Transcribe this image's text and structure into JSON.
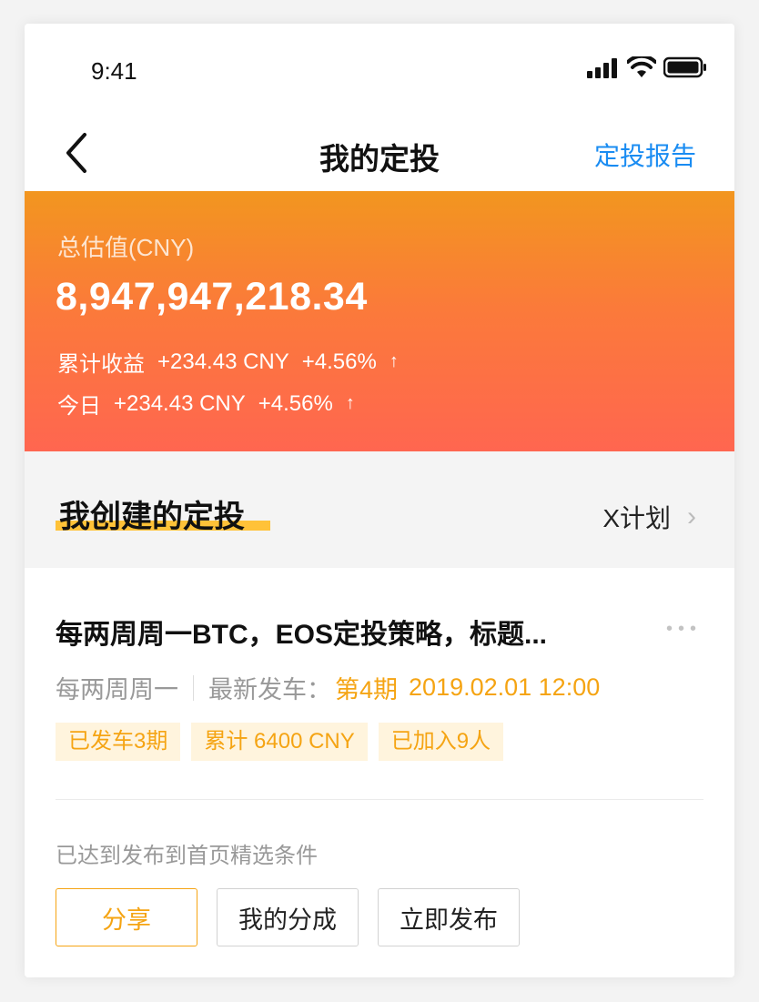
{
  "status_bar": {
    "time": "9:41"
  },
  "nav": {
    "title": "我的定投",
    "report_link": "定投报告"
  },
  "summary": {
    "total_label": "总估值(CNY)",
    "total_value": "8,947,947,218.34",
    "cumulative_label": "累计收益",
    "cumulative_amount": "+234.43 CNY",
    "cumulative_percent": "+4.56%",
    "today_label": "今日",
    "today_amount": "+234.43 CNY",
    "today_percent": "+4.56%",
    "arrow": "↑"
  },
  "section": {
    "title": "我创建的定投",
    "plan_link": "X计划",
    "chevron": "›"
  },
  "card": {
    "title": "每两周周一BTC，EOS定投策略，标题...",
    "more": "•••",
    "frequency": "每两周周一",
    "latest_label": "最新发车：",
    "latest_period": "第4期",
    "latest_time": "2019.02.01 12:00",
    "tags": [
      "已发车3期",
      "累计 6400 CNY",
      "已加入9人"
    ],
    "condition_text": "已达到发布到首页精选条件",
    "buttons": {
      "share": "分享",
      "my_share": "我的分成",
      "publish": "立即发布"
    }
  },
  "colors": {
    "accent": "#f5a413",
    "link": "#1a8cf2",
    "gradient_top": "#f2961f",
    "gradient_bottom": "#ff6650"
  }
}
